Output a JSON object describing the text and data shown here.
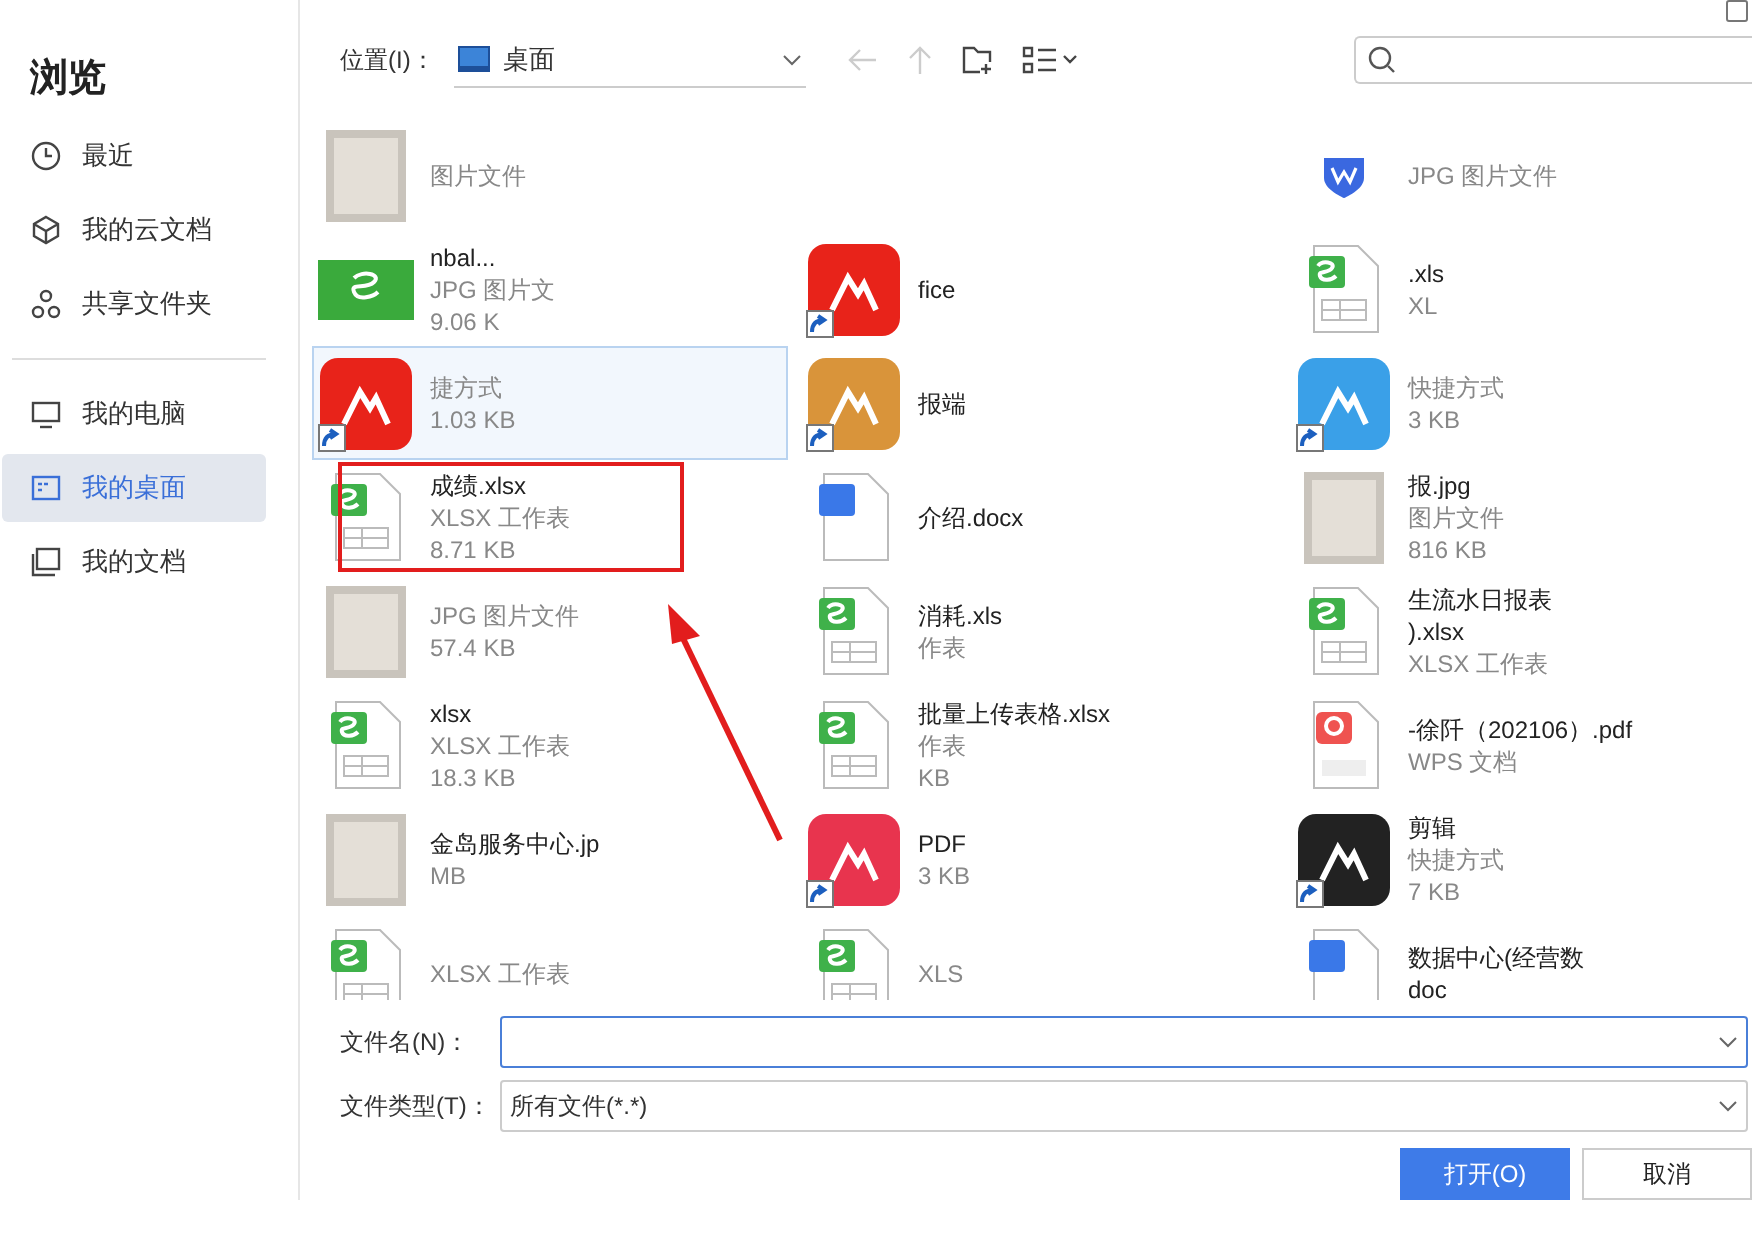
{
  "sidebar": {
    "title": "浏览",
    "items": [
      {
        "label": "最近",
        "selected": false
      },
      {
        "label": "我的云文档",
        "selected": false
      },
      {
        "label": "共享文件夹",
        "selected": false
      },
      {
        "label": "我的电脑",
        "selected": false
      },
      {
        "label": "我的桌面",
        "selected": true
      },
      {
        "label": "我的文档",
        "selected": false
      }
    ]
  },
  "toolbar": {
    "location_label": "位置(I)：",
    "location": "桌面",
    "back_disabled": true,
    "up_disabled": true
  },
  "files": [
    {
      "kind": "photo",
      "type": "图片文件",
      "shortcut": false,
      "selected": false
    },
    {
      "kind": "blank"
    },
    {
      "kind": "wps",
      "type": "JPG 图片文件",
      "shortcut": false,
      "selected": false
    },
    {
      "kind": "sheet",
      "name": "nbal...",
      "type": "JPG 图片文",
      "size": "9.06 K",
      "shortcut": false,
      "selected": false
    },
    {
      "kind": "app",
      "color": "#e8231a",
      "name": "fice",
      "shortcut": true,
      "selected": false
    },
    {
      "kind": "xlsx",
      "name": ".xls",
      "type": "XL",
      "shortcut": false,
      "selected": false
    },
    {
      "kind": "app",
      "color": "#e8231a",
      "type": "捷方式",
      "size": "1.03 KB",
      "shortcut": true,
      "selected": true
    },
    {
      "kind": "app",
      "color": "#d9943a",
      "name": "报端",
      "shortcut": true,
      "selected": false
    },
    {
      "kind": "app",
      "color": "#3aa0e8",
      "type": "快捷方式",
      "size": "3 KB",
      "shortcut": true,
      "selected": false
    },
    {
      "kind": "xlsx",
      "name": "成绩.xlsx",
      "type": "XLSX 工作表",
      "size": "8.71 KB",
      "shortcut": false,
      "selected": false
    },
    {
      "kind": "docx",
      "name": "介绍.docx",
      "shortcut": false,
      "selected": false
    },
    {
      "kind": "photo",
      "name": "报.jpg",
      "type": "图片文件",
      "size": "816 KB",
      "shortcut": false,
      "selected": false
    },
    {
      "kind": "photo",
      "type": "JPG 图片文件",
      "size": "57.4 KB",
      "shortcut": false,
      "selected": false
    },
    {
      "kind": "xlsx",
      "name": "消耗.xls",
      "type": "作表",
      "shortcut": false,
      "selected": false
    },
    {
      "kind": "xlsx",
      "name": "生流水日报表",
      "name2": ").xlsx",
      "type": "XLSX 工作表",
      "shortcut": false,
      "selected": false
    },
    {
      "kind": "xlsx",
      "name": "xlsx",
      "type": "XLSX 工作表",
      "size": "18.3 KB",
      "shortcut": false,
      "selected": false
    },
    {
      "kind": "xlsx",
      "name": "批量上传表格.xlsx",
      "type": "作表",
      "size": "KB",
      "shortcut": false,
      "selected": false
    },
    {
      "kind": "pdf",
      "name": "-徐阡（202106）.pdf",
      "type": "WPS 文档",
      "shortcut": false,
      "selected": false
    },
    {
      "kind": "photo",
      "name": "金岛服务中心.jp",
      "size": "MB",
      "shortcut": false,
      "selected": false
    },
    {
      "kind": "app",
      "color": "#e8344e",
      "name": "PDF",
      "size": "3 KB",
      "shortcut": true,
      "selected": false
    },
    {
      "kind": "app",
      "color": "#222222",
      "name": "剪辑",
      "type": "快捷方式",
      "size": "7 KB",
      "shortcut": true,
      "selected": false
    },
    {
      "kind": "xlsx",
      "type": "XLSX 工作表",
      "shortcut": false,
      "selected": false
    },
    {
      "kind": "xlsx",
      "type": "XLS",
      "shortcut": false,
      "selected": false
    },
    {
      "kind": "docx",
      "name": "数据中心(经营数",
      "name2": "doc",
      "shortcut": false,
      "selected": false
    }
  ],
  "footer": {
    "filename_label": "文件名(N)：",
    "filetype_label": "文件类型(T)：",
    "filetype": "所有文件(*.*)",
    "open": "打开(O)",
    "cancel": "取消"
  }
}
